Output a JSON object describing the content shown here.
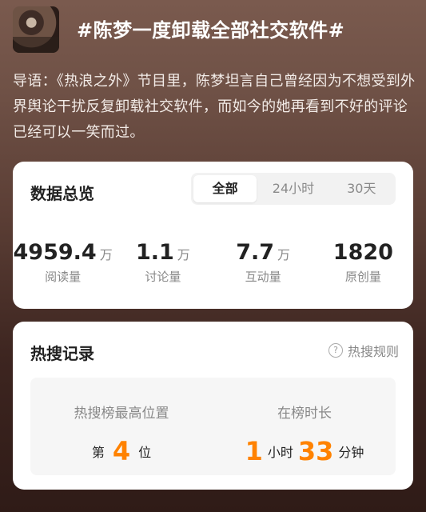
{
  "header": {
    "topic": "#陈梦一度卸载全部社交软件#"
  },
  "lead": {
    "text": "导语：《热浪之外》节目里，陈梦坦言自己曾经因为不想受到外界舆论干扰反复卸载社交软件，而如今的她再看到不好的评论已经可以一笑而过。"
  },
  "overview": {
    "title": "数据总览",
    "tabs": [
      {
        "label": "全部",
        "active": true
      },
      {
        "label": "24小时",
        "active": false
      },
      {
        "label": "30天",
        "active": false
      }
    ],
    "stats": [
      {
        "value": "4959.4",
        "unit": "万",
        "label": "阅读量"
      },
      {
        "value": "1.1",
        "unit": "万",
        "label": "讨论量"
      },
      {
        "value": "7.7",
        "unit": "万",
        "label": "互动量"
      },
      {
        "value": "1820",
        "unit": "",
        "label": "原创量"
      }
    ]
  },
  "hot": {
    "title": "热搜记录",
    "rules_label": "热搜规则",
    "rules_icon": "question-circle-icon",
    "peak": {
      "head": "热搜榜最高位置",
      "prefix": "第",
      "value": "4",
      "suffix": "位"
    },
    "duration": {
      "head": "在榜时长",
      "hours": "1",
      "hours_unit": "小时",
      "minutes": "33",
      "minutes_unit": "分钟"
    }
  },
  "colors": {
    "accent": "#ff8200",
    "card_bg": "#ffffff"
  }
}
